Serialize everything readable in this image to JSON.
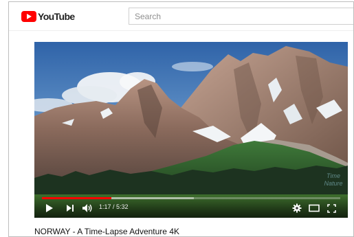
{
  "header": {
    "logo_text": "YouTube",
    "brand_color": "#ff0000",
    "search_placeholder": "Search"
  },
  "player": {
    "current_time": "1:17",
    "duration": "5:32",
    "time_separator": " / ",
    "progress_played": 0.232,
    "progress_loaded": 0.51,
    "watermark_text": "Time Nature",
    "accent_color": "#ff0000",
    "icons": {
      "play": "play-icon",
      "next": "next-icon",
      "volume": "volume-icon",
      "settings": "gear-icon",
      "theater": "theater-mode-icon",
      "fullscreen": "fullscreen-icon"
    }
  },
  "video": {
    "title": "NORWAY - A Time-Lapse Adventure 4K"
  }
}
